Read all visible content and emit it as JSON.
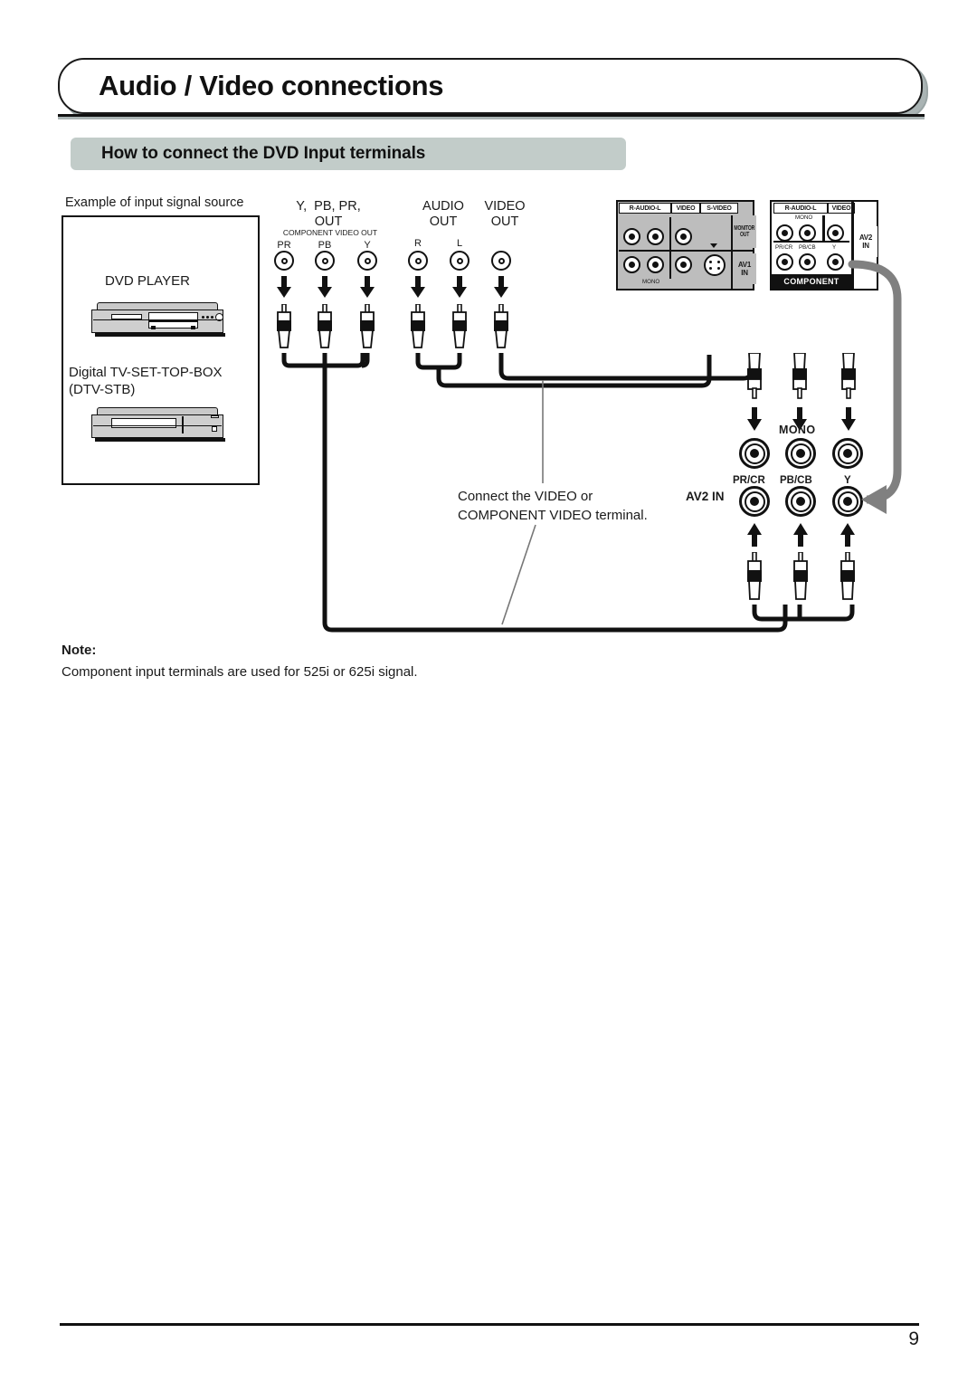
{
  "header": {
    "title": "Audio / Video connections",
    "subheading": "How to connect the DVD Input terminals"
  },
  "source": {
    "caption": "Example of input signal source",
    "devices": [
      {
        "name": "DVD PLAYER",
        "icon": "dvd-player-icon"
      },
      {
        "name": "Digital TV-SET-TOP-BOX",
        "name2": "(DTV-STB)",
        "icon": "set-top-box-icon"
      }
    ]
  },
  "connectors": {
    "component_group_title_line1": "Y,  PB, PR,",
    "component_group_title_line2": "OUT",
    "component_row_label": "COMPONENT VIDEO OUT",
    "component_jacks": [
      "PR",
      "PB",
      "Y"
    ],
    "audio_title_line1": "AUDIO",
    "audio_title_line2": "OUT",
    "audio_jacks": [
      "R",
      "L"
    ],
    "video_title_line1": "VIDEO",
    "video_title_line2": "OUT",
    "video_jacks": [
      ""
    ]
  },
  "tv_panel_left": {
    "top_tags": [
      "R-AUDIO-L",
      "VIDEO",
      "S-VIDEO"
    ],
    "mono_label": "MONO",
    "side_tags": [
      "MONITOR OUT",
      "AV1 IN"
    ],
    "monitor_out_line1": "MONITOR",
    "monitor_out_line2": "OUT",
    "av1_line1": "AV1",
    "av1_line2": "IN"
  },
  "tv_panel_right": {
    "top_tags": [
      "R-AUDIO-L",
      "VIDEO"
    ],
    "mono_label": "MONO",
    "component_labels": [
      "PR/CR",
      "PB/CB",
      "Y"
    ],
    "component_band": "COMPONENT",
    "av2_line1": "AV2",
    "av2_line2": "IN"
  },
  "av2_detail": {
    "section_label": "AV2 IN",
    "mono_label": "MONO",
    "jack_labels": [
      "PR/CR",
      "PB/CB",
      "Y"
    ]
  },
  "callout": {
    "line1": "Connect the VIDEO or",
    "line2": "COMPONENT VIDEO terminal."
  },
  "note": {
    "label": "Note:",
    "text": "Component input terminals are used for 525i or 625i signal."
  },
  "footer": {
    "page_number": "9"
  },
  "colors": {
    "ink": "#1a1a1a",
    "subhead_bg": "#c2ccc9",
    "panel_gray": "#bdbdbd",
    "shadow_gray": "#aab4b4",
    "arrow_gray": "#808080"
  }
}
